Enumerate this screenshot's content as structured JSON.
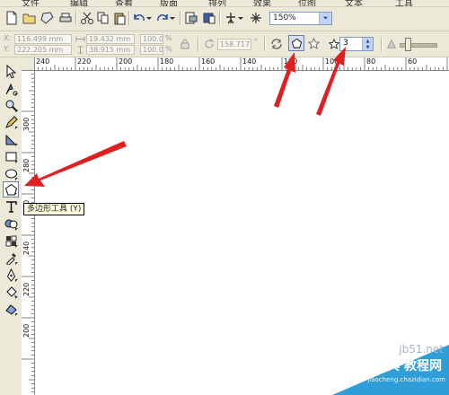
{
  "menu": {
    "items": [
      "文件",
      "编辑",
      "查看",
      "版面",
      "排列",
      "效果",
      "位图",
      "文本",
      "工具"
    ]
  },
  "toolbar": {
    "zoom_value": "150%"
  },
  "property_bar": {
    "x_label": "X:",
    "y_label": "Y:",
    "x_value": "116.499 mm",
    "y_value": "222.205 mm",
    "width_value": "19.432 mm",
    "height_value": "38.915 mm",
    "scale_x": "100.0",
    "scale_y": "100.0",
    "pct": "%",
    "angle_value": "158.717",
    "degree": "°",
    "points_value": "3"
  },
  "tooltip": {
    "text": "多边形工具 (Y)"
  },
  "ruler_top": {
    "labels": [
      "240",
      "220",
      "200",
      "180",
      "160",
      "140",
      "120",
      "100",
      "80",
      "60"
    ]
  },
  "ruler_left": {
    "labels": [
      "300",
      "280",
      "260",
      "240",
      "220",
      "200"
    ]
  },
  "watermark": {
    "site": "jb51.net",
    "cn": "查字典 教程网",
    "url": "jiaocheng.chazidian.com"
  },
  "colors": {
    "arrow": "#e02020",
    "chrome": "#ece9d8",
    "watermark_bg": "#2f9ed8"
  },
  "icons": {
    "active_polygon_tool": "pentagon-icon",
    "star_mode": "star-icon"
  }
}
